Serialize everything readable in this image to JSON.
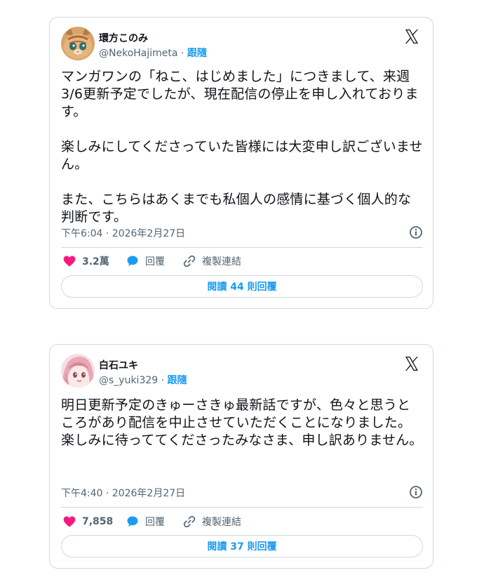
{
  "tweets": [
    {
      "display_name": "環方このみ",
      "handle": "@NekoHajimeta",
      "follow_label": "跟隨",
      "text": "マンガワンの「ねこ、はじめました」につきまして、来週3/6更新予定でしたが、現在配信の停止を申し入れております。\n\n楽しみにしてくださっていた皆様には大変申し訳ございません。\n\nまた、こちらはあくまでも私個人の感情に基づく個人的な判断です。",
      "timestamp": "下午6:04 · 2026年2月27日",
      "likes": "3.2萬",
      "reply_label": "回覆",
      "copy_link_label": "複製連結",
      "read_replies_label": "閱讀 44 則回覆"
    },
    {
      "display_name": "白石ユキ",
      "handle": "@s_yuki329",
      "follow_label": "跟隨",
      "text": "明日更新予定のきゅーさきゅ最新話ですが、色々と思うところがあり配信を中止させていただくことになりました。\n楽しみに待っててくださったみなさま、申し訳ありません。",
      "timestamp": "下午4:40 · 2026年2月27日",
      "likes": "7,858",
      "reply_label": "回覆",
      "copy_link_label": "複製連結",
      "read_replies_label": "閱讀 37 則回覆"
    }
  ],
  "icons": {
    "logo": "x-logo-icon",
    "info": "info-icon",
    "like": "heart-icon",
    "reply": "speech-bubble-icon",
    "copy": "link-icon"
  },
  "colors": {
    "accent": "#1d9bf0",
    "like": "#f91880",
    "text": "#0f1419",
    "muted": "#536471",
    "border": "#cfd9de"
  }
}
